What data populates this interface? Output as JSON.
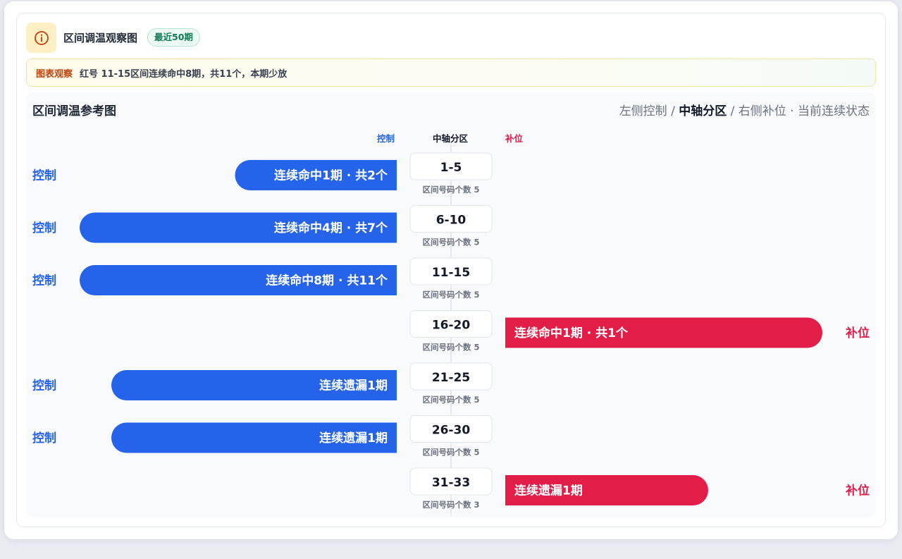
{
  "header": {
    "title": "区间调温观察图",
    "badge": "最近50期"
  },
  "observation": {
    "tag": "图表观察",
    "text": "红号 11-15区间连续命中8期，共11个，本期少放"
  },
  "panel": {
    "title": "区间调温参考图",
    "legend": {
      "left": "左侧控制",
      "sep1": " / ",
      "center": "中轴分区",
      "sep2": " / ",
      "right": "右侧补位",
      "sep3": " · ",
      "state": "当前连续状态"
    },
    "columns": {
      "left": "控制",
      "center": "中轴分区",
      "right": "补位"
    }
  },
  "colors": {
    "control": "#2563eb",
    "fill": "#e11d48",
    "badge_text": "#0f7a55",
    "obs_tag": "#c2410c"
  },
  "chart_data": {
    "type": "bar",
    "categories": [
      "1-5",
      "6-10",
      "11-15",
      "16-20",
      "21-25",
      "26-30",
      "31-33"
    ],
    "rows": [
      {
        "range": "1-5",
        "sub": "区间号码个数 5",
        "side": "控制",
        "bar_label": "连续命中1期 · 共2个",
        "level": 0.51
      },
      {
        "range": "6-10",
        "sub": "区间号码个数 5",
        "side": "控制",
        "bar_label": "连续命中4期 · 共7个",
        "level": 1.0
      },
      {
        "range": "11-15",
        "sub": "区间号码个数 5",
        "side": "控制",
        "bar_label": "连续命中8期 · 共11个",
        "level": 1.0
      },
      {
        "range": "16-20",
        "sub": "区间号码个数 5",
        "side": "补位",
        "bar_label": "连续命中1期 · 共1个",
        "level": 1.0
      },
      {
        "range": "21-25",
        "sub": "区间号码个数 5",
        "side": "控制",
        "bar_label": "连续遗漏1期",
        "level": 0.9
      },
      {
        "range": "26-30",
        "sub": "区间号码个数 5",
        "side": "控制",
        "bar_label": "连续遗漏1期",
        "level": 0.9
      },
      {
        "range": "31-33",
        "sub": "区间号码个数 3",
        "side": "补位",
        "bar_label": "连续遗漏1期",
        "level": 0.64
      }
    ]
  }
}
